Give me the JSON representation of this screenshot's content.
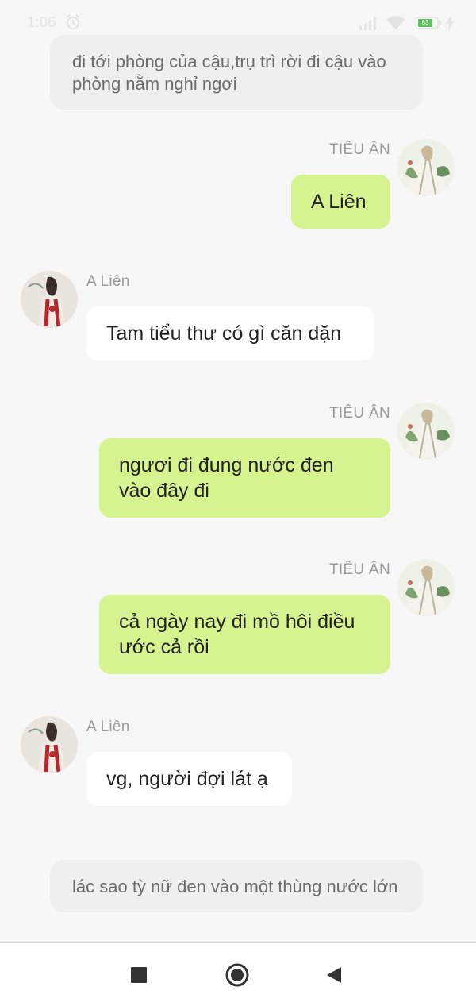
{
  "status_bar": {
    "time": "1:06",
    "battery_level": "63",
    "icons": [
      "alarm-icon",
      "signal-icon",
      "wifi-icon",
      "battery-icon",
      "charge-icon"
    ]
  },
  "colors": {
    "background": "#f7f7f7",
    "my_bubble": "#d6f38f",
    "other_bubble": "#ffffff",
    "narration": "#efefef",
    "name_text": "#9a9a9a"
  },
  "chat": {
    "narration_top": "đi tới phòng của cậu,trụ trì rời đi cậu vào phòng nằm nghỉ ngơi",
    "messages": [
      {
        "sender": "TIÊU ÂN",
        "side": "right",
        "text": "A Liên"
      },
      {
        "sender": "A Liên",
        "side": "left",
        "text": "Tam tiểu thư có gì căn dặn"
      },
      {
        "sender": "TIÊU ÂN",
        "side": "right",
        "text": "ngươi đi đung nước đen vào đây đi"
      },
      {
        "sender": "TIÊU ÂN",
        "side": "right",
        "text": "cả ngày nay đi mồ hôi điều ước cả rồi"
      },
      {
        "sender": "A Liên",
        "side": "left",
        "text": "vg, người đợi lát ạ"
      }
    ],
    "narration_bottom": "lác sao tỳ nữ đen vào một thùng nước lớn"
  },
  "nav_bar": {
    "buttons": [
      "recents-square-icon",
      "home-circle-icon",
      "back-triangle-icon"
    ]
  }
}
